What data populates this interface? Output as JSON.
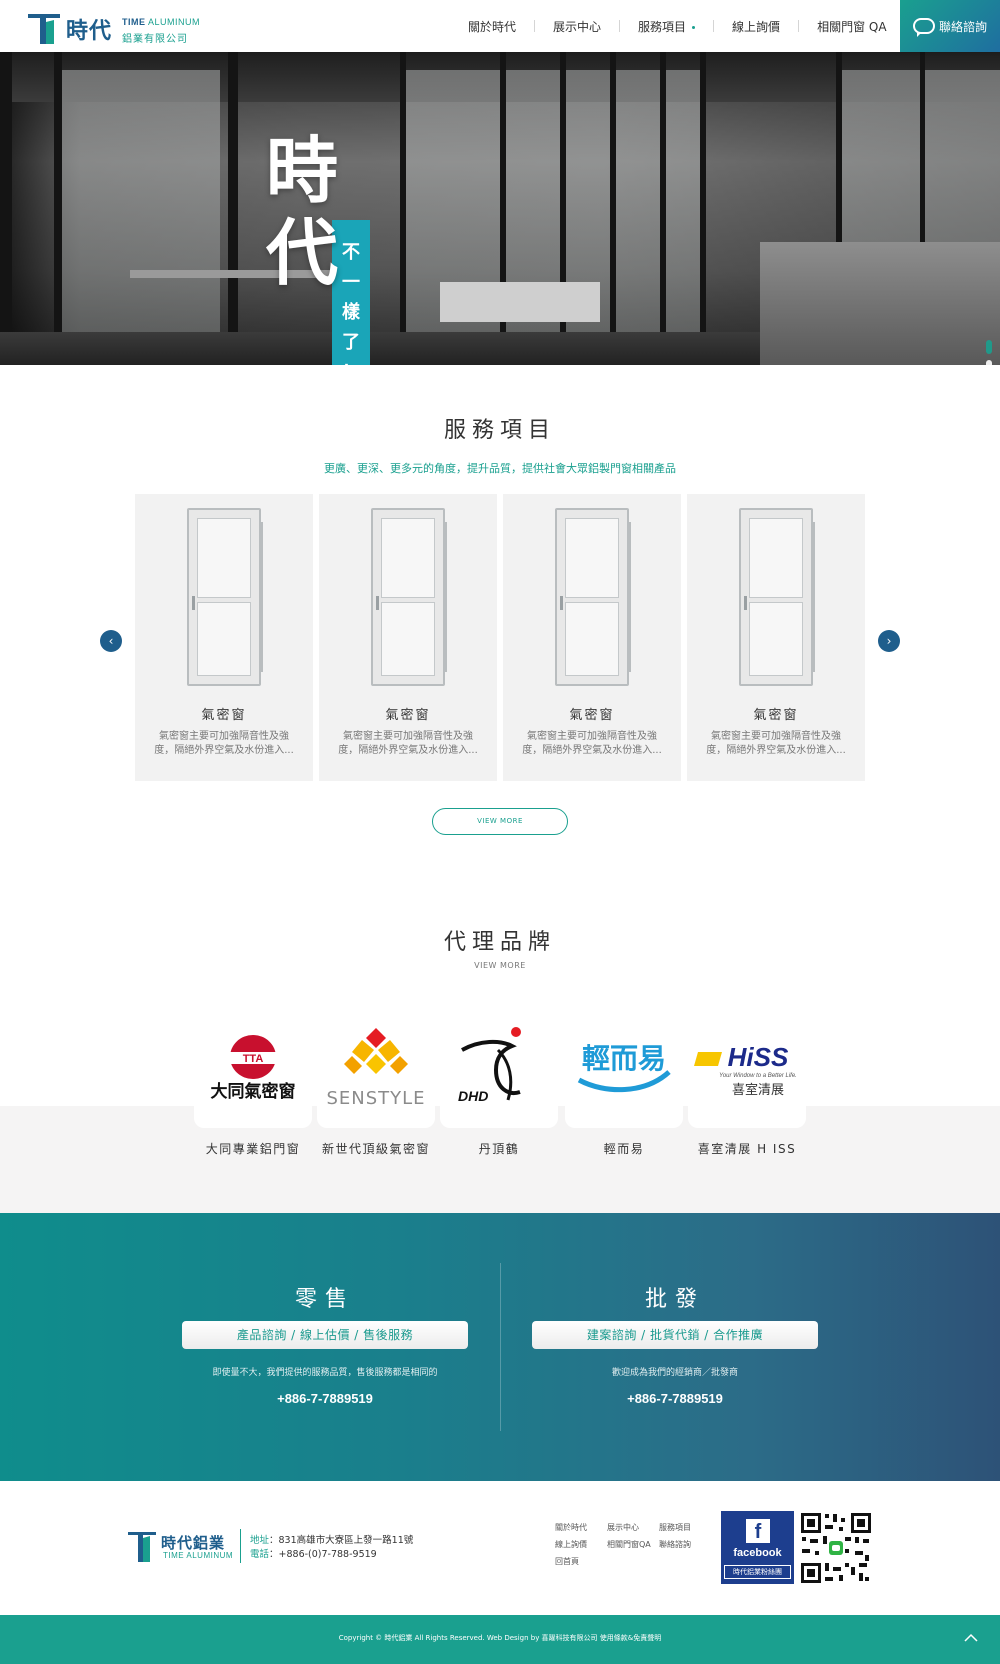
{
  "brand": {
    "logo_cn": "時代",
    "logo_en_bold": "TIME",
    "logo_en": "ALUMINUM",
    "logo_sub": "鋁業有限公司"
  },
  "nav": {
    "items": [
      "關於時代",
      "展示中心",
      "服務項目",
      "線上詢價",
      "相關門窗 QA"
    ],
    "contact_label": "聯絡諮詢"
  },
  "hero": {
    "title_line1": "時",
    "title_line2": "代",
    "strip_text": [
      "不",
      "一",
      "樣",
      "了",
      "！"
    ]
  },
  "services": {
    "title": "服務項目",
    "subtitle": "更廣、更深、更多元的角度，提升品質，提供社會大眾鋁製門窗相關產品",
    "cards": [
      {
        "name": "氣密窗",
        "desc": "氣密窗主要可加強隔音性及強度，隔絕外界空氣及水份進入..."
      },
      {
        "name": "氣密窗",
        "desc": "氣密窗主要可加強隔音性及強度，隔絕外界空氣及水份進入..."
      },
      {
        "name": "氣密窗",
        "desc": "氣密窗主要可加強隔音性及強度，隔絕外界空氣及水份進入..."
      },
      {
        "name": "氣密窗",
        "desc": "氣密窗主要可加強隔音性及強度，隔絕外界空氣及水份進入..."
      }
    ],
    "view_more": "VIEW MORE",
    "prev_icon": "‹",
    "next_icon": "›"
  },
  "brands": {
    "title": "代理品牌",
    "subtitle": "VIEW MORE",
    "items": [
      {
        "name": "大同專業鋁門窗",
        "logo_text": "大同氣密窗",
        "logo_badge": "TTA"
      },
      {
        "name": "新世代頂級氣密窗",
        "logo_text": "SENSTYLE"
      },
      {
        "name": "丹頂鶴",
        "logo_text": "DHD"
      },
      {
        "name": "輕而易",
        "logo_text": "輕而易"
      },
      {
        "name": "喜室清展 H ISS",
        "logo_text": "HiSS",
        "logo_tagline": "Your Window to a Better Life.",
        "logo_cn": "喜室清展"
      }
    ]
  },
  "contact": {
    "retail": {
      "title": "零售",
      "pill": "產品諮詢 / 線上估價 / 售後服務",
      "note": "即使量不大，我們提供的服務品質，售後服務都是相同的",
      "phone": "+886-7-7889519"
    },
    "wholesale": {
      "title": "批發",
      "pill": "建案諮詢 / 批貨代銷 / 合作推廣",
      "note": "歡迎成為我們的經銷商／批發商",
      "phone": "+886-7-7889519"
    }
  },
  "footer": {
    "logo_cn": "時代鋁業",
    "logo_en_bold": "TIME",
    "logo_en": "ALUMINUM",
    "address_label": "地址",
    "address": "：831高雄市大寮區上發一路11號",
    "phone_label": "電話",
    "phone": "：+886-(0)7-788-9519",
    "links": [
      "關於時代",
      "展示中心",
      "服務項目",
      "線上詢價",
      "相關門窗QA",
      "聯絡諮詢",
      "回首頁"
    ],
    "fb_word": "facebook",
    "fb_tag": "時代鋁業粉絲團",
    "copyright": "Copyright © 時代鋁業 All Rights Reserved. Web Design by 喜躍科技有限公司 使用條款&免責聲明"
  },
  "colors": {
    "accent": "#1aa08f",
    "brand_blue": "#1f5e8c",
    "band_start": "#0f8d8c",
    "band_end": "#2d5277"
  }
}
